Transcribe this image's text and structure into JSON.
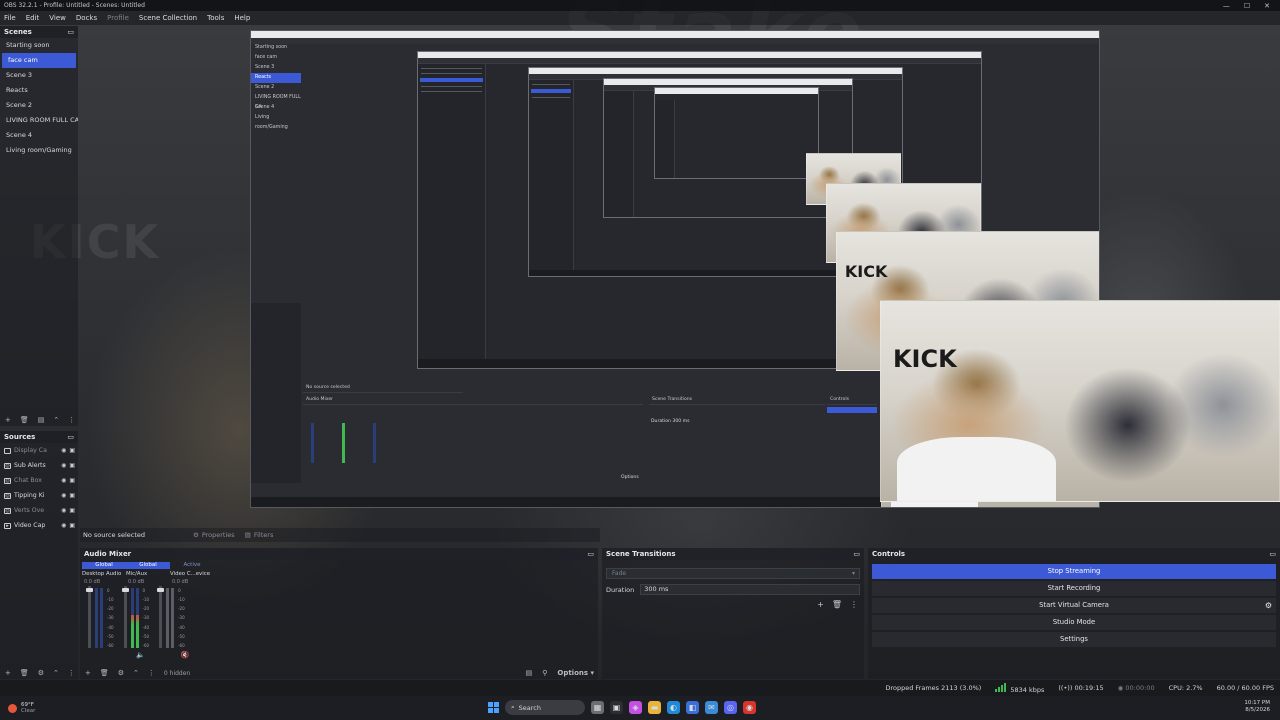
{
  "window": {
    "title": "OBS 32.2.1 - Profile: Untitled - Scenes: Untitled",
    "controls": [
      "—",
      "☐",
      "✕"
    ]
  },
  "menu": {
    "items": [
      "File",
      "Edit",
      "View",
      "Docks",
      "Profile",
      "Scene Collection",
      "Tools",
      "Help"
    ]
  },
  "scenes": {
    "title": "Scenes",
    "items": [
      "Starting soon",
      "face cam",
      "Scene 3",
      "Reacts",
      "Scene 2",
      "LIVING ROOM FULL CA",
      "Scene 4",
      "Living room/Gaming"
    ],
    "active_index": 1
  },
  "sources": {
    "title": "Sources",
    "items": [
      {
        "label": "Display Ca",
        "dimmed": true
      },
      {
        "label": "Sub Alerts",
        "dimmed": false
      },
      {
        "label": "Chat Box",
        "dimmed": true
      },
      {
        "label": "Tipping Ki",
        "dimmed": false
      },
      {
        "label": "Verts Ove",
        "dimmed": true
      },
      {
        "label": "Video Cap",
        "dimmed": false
      }
    ]
  },
  "source_bar": {
    "no_source": "No source selected",
    "properties": "Properties",
    "filters": "Filters"
  },
  "preview": {
    "overlay_scenes": [
      "Starting soon",
      "face cam",
      "Scene 3",
      "Reacts",
      "Scene 2",
      "LIVING ROOM FULL CA",
      "Scene 4",
      "Living room/Gaming"
    ],
    "overlay_audio_mixer": "Audio Mixer",
    "overlay_transitions": "Scene Transitions",
    "overlay_controls": "Controls",
    "overlay_duration": "Duration",
    "overlay_duration_value": "300 ms",
    "overlay_options": "Options",
    "overlay_no_source": "No source selected",
    "overlay_kick": "KICK"
  },
  "mixer": {
    "title": "Audio Mixer",
    "tabs": [
      "Global",
      "Global",
      "Active"
    ],
    "channels": [
      {
        "name": "Desktop Audio",
        "db": "0.0 dB",
        "level": 0.0
      },
      {
        "name": "Mic/Aux",
        "db": "0.0 dB",
        "level": 0.55
      },
      {
        "name": "Video C...evice 3",
        "db": "0.0 dB",
        "level": 0.0
      }
    ],
    "scale": [
      "0",
      "-5",
      "-10",
      "-15",
      "-20",
      "-25",
      "-30",
      "-35",
      "-40",
      "-45",
      "-50",
      "-55",
      "-60"
    ],
    "hidden": "0 hidden",
    "options": "Options"
  },
  "transitions": {
    "title": "Scene Transitions",
    "selected": "Fade",
    "duration_label": "Duration",
    "duration_value": "300 ms"
  },
  "controls": {
    "title": "Controls",
    "buttons": [
      "Stop Streaming",
      "Start Recording",
      "Start Virtual Camera",
      "Studio Mode",
      "Settings"
    ]
  },
  "status": {
    "dropped": "Dropped Frames 2113 (3.0%)",
    "kbps": "5834 kbps",
    "stream_time": "00:19:15",
    "rec_time": "00:00:00",
    "cpu": "CPU: 2.7%",
    "fps": "60.00 / 60.00 FPS"
  },
  "taskbar": {
    "weather_temp": "69°F",
    "weather_desc": "Clear",
    "search": "Search",
    "time": "10:17 PM",
    "date": "8/5/2026"
  },
  "colors": {
    "accent": "#3d5ad6",
    "meter_green": "#3fb950",
    "meter_red": "#d24a3a"
  }
}
